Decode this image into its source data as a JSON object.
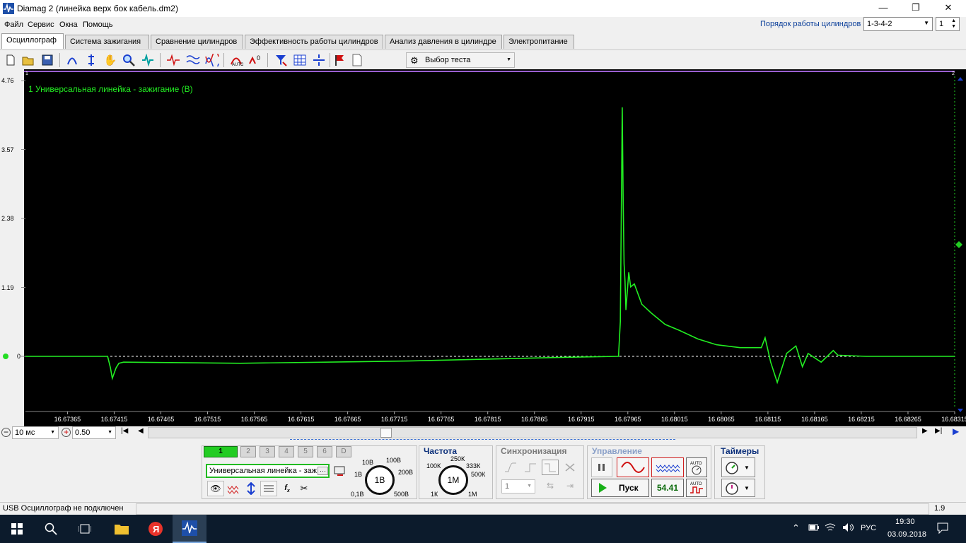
{
  "window": {
    "title": "Diamag 2 (линейка верх бок кабель.dm2)",
    "minimize": "—",
    "maximize": "❐",
    "close": "✕"
  },
  "menu": {
    "items": [
      "Файл",
      "Сервис",
      "Окна",
      "Помощь"
    ]
  },
  "cylinder_order": {
    "label": "Порядок работы цилиндров",
    "value": "1-3-4-2",
    "cylinder": "1"
  },
  "tabs": [
    "Осциллограф",
    "Система зажигания",
    "Сравнение цилиндров",
    "Эффективность работы цилиндров",
    "Анализ давления в цилиндре",
    "Электропитание"
  ],
  "toolbar": {
    "test_select": "Выбор теста"
  },
  "scope": {
    "channel_label": "1 Универсальная линейка - зажигание (В)",
    "marker_left": "1",
    "marker_right": "2",
    "colors": {
      "trace": "#22ee22",
      "background": "#000000",
      "grid_line": "#ffffff"
    },
    "y_ticks": [
      "4.76",
      "3.57",
      "2.38",
      "1.19",
      "0"
    ],
    "x_ticks": [
      "16.67365",
      "16.67415",
      "16.67465",
      "16.67515",
      "16.67565",
      "16.67615",
      "16.67665",
      "16.67715",
      "16.67765",
      "16.67815",
      "16.67865",
      "16.67915",
      "16.67965",
      "16.68015",
      "16.68065",
      "16.68115",
      "16.68165",
      "16.68215",
      "16.68265",
      "16.68315"
    ]
  },
  "chart_data": {
    "type": "line",
    "title": "1 Универсальная линейка - зажигание (В)",
    "xlabel": "",
    "ylabel": "",
    "ylim": [
      -0.8,
      4.76
    ],
    "xlim": [
      16.6732,
      16.68315
    ],
    "grid": false,
    "series": [
      {
        "name": "1 Универсальная линейка - зажигание (В)",
        "x": [
          16.6732,
          16.67408,
          16.67411,
          16.67413,
          16.67417,
          16.6742,
          16.67425,
          16.6755,
          16.6773,
          16.6789,
          16.67955,
          16.67957,
          16.67959,
          16.6796,
          16.67961,
          16.67962,
          16.67963,
          16.67966,
          16.67968,
          16.67972,
          16.6798,
          16.6799,
          16.68005,
          16.6802,
          16.6804,
          16.6806,
          16.68085,
          16.68108,
          16.68112,
          16.68118,
          16.68125,
          16.68135,
          16.68145,
          16.68152,
          16.68158,
          16.68172,
          16.68185,
          16.6819,
          16.6822,
          16.68315
        ],
        "y": [
          0.0,
          0.0,
          -0.2,
          -0.38,
          -0.2,
          -0.12,
          -0.1,
          -0.12,
          -0.08,
          -0.02,
          0.0,
          0.6,
          4.3,
          2.7,
          1.6,
          1.3,
          0.8,
          1.45,
          1.2,
          1.25,
          0.9,
          0.75,
          0.55,
          0.45,
          0.3,
          0.2,
          0.15,
          0.15,
          0.32,
          -0.1,
          -0.45,
          0.05,
          0.18,
          -0.18,
          0.05,
          -0.1,
          0.1,
          0.02,
          0.0,
          0.0
        ]
      }
    ]
  },
  "nav": {
    "timebase": "10 мс",
    "scale": "0.50"
  },
  "channels": {
    "buttons": [
      "1",
      "2",
      "3",
      "4",
      "5",
      "6",
      "D"
    ],
    "probe": "Универсальная линейка - заж"
  },
  "voltage": {
    "knob": "1В",
    "labels": [
      "10В",
      "100В",
      "1В",
      "200В",
      "0,1В",
      "500В"
    ]
  },
  "frequency": {
    "title": "Частота",
    "knob": "1М",
    "labels": [
      "250К",
      "100К",
      "333К",
      "500К",
      "1К",
      "1М"
    ]
  },
  "sync": {
    "title": "Синхронизация",
    "value": "1"
  },
  "control": {
    "title": "Управление",
    "start": "Пуск",
    "counter": "54.41",
    "auto": "AUTO"
  },
  "timers": {
    "title": "Таймеры"
  },
  "status": {
    "message": "USB Осциллограф не подключен",
    "version": "1.9"
  },
  "taskbar": {
    "lang": "РУС",
    "time": "19:30",
    "date": "03.09.2018"
  }
}
